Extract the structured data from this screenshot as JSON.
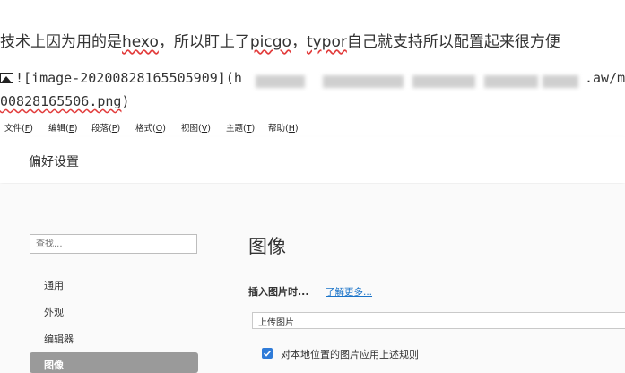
{
  "document": {
    "line1_a": "技术上因为用的是",
    "line1_hexo": "hexo",
    "line1_b": "，所以盯上了",
    "line1_picgo": "picgo",
    "line1_c": "，",
    "line1_typor": "typor",
    "line1_d": "自己就支持所以配置起来很方便",
    "line2_start": "![image-20200828165505909](h",
    "line2_end": ".aw/m",
    "line3_file": "00828165506.png",
    "line3_close": ")"
  },
  "menubar": [
    {
      "label": "文件(",
      "acc": "F",
      "end": ")"
    },
    {
      "label": "编辑(",
      "acc": "E",
      "end": ")"
    },
    {
      "label": "段落(",
      "acc": "P",
      "end": ")"
    },
    {
      "label": "格式(",
      "acc": "O",
      "end": ")"
    },
    {
      "label": "视图(",
      "acc": "V",
      "end": ")"
    },
    {
      "label": "主题(",
      "acc": "T",
      "end": ")"
    },
    {
      "label": "帮助(",
      "acc": "H",
      "end": ")"
    }
  ],
  "prefs": {
    "title": "偏好设置",
    "search_placeholder": "查找...",
    "nav": [
      "通用",
      "外观",
      "编辑器",
      "图像"
    ],
    "active_nav": "图像"
  },
  "image_section": {
    "heading": "图像",
    "insert_label": "插入图片时...",
    "learn_more": "了解更多...",
    "upload_option": "上传图片",
    "checkbox1": "对本地位置的图片应用上述规则",
    "checkbox1_checked": true
  },
  "colors": {
    "accent": "#2f7bd8",
    "link": "#1a73c8",
    "active_nav_bg": "#9a9a9a",
    "spell_error": "#e23b3b"
  }
}
